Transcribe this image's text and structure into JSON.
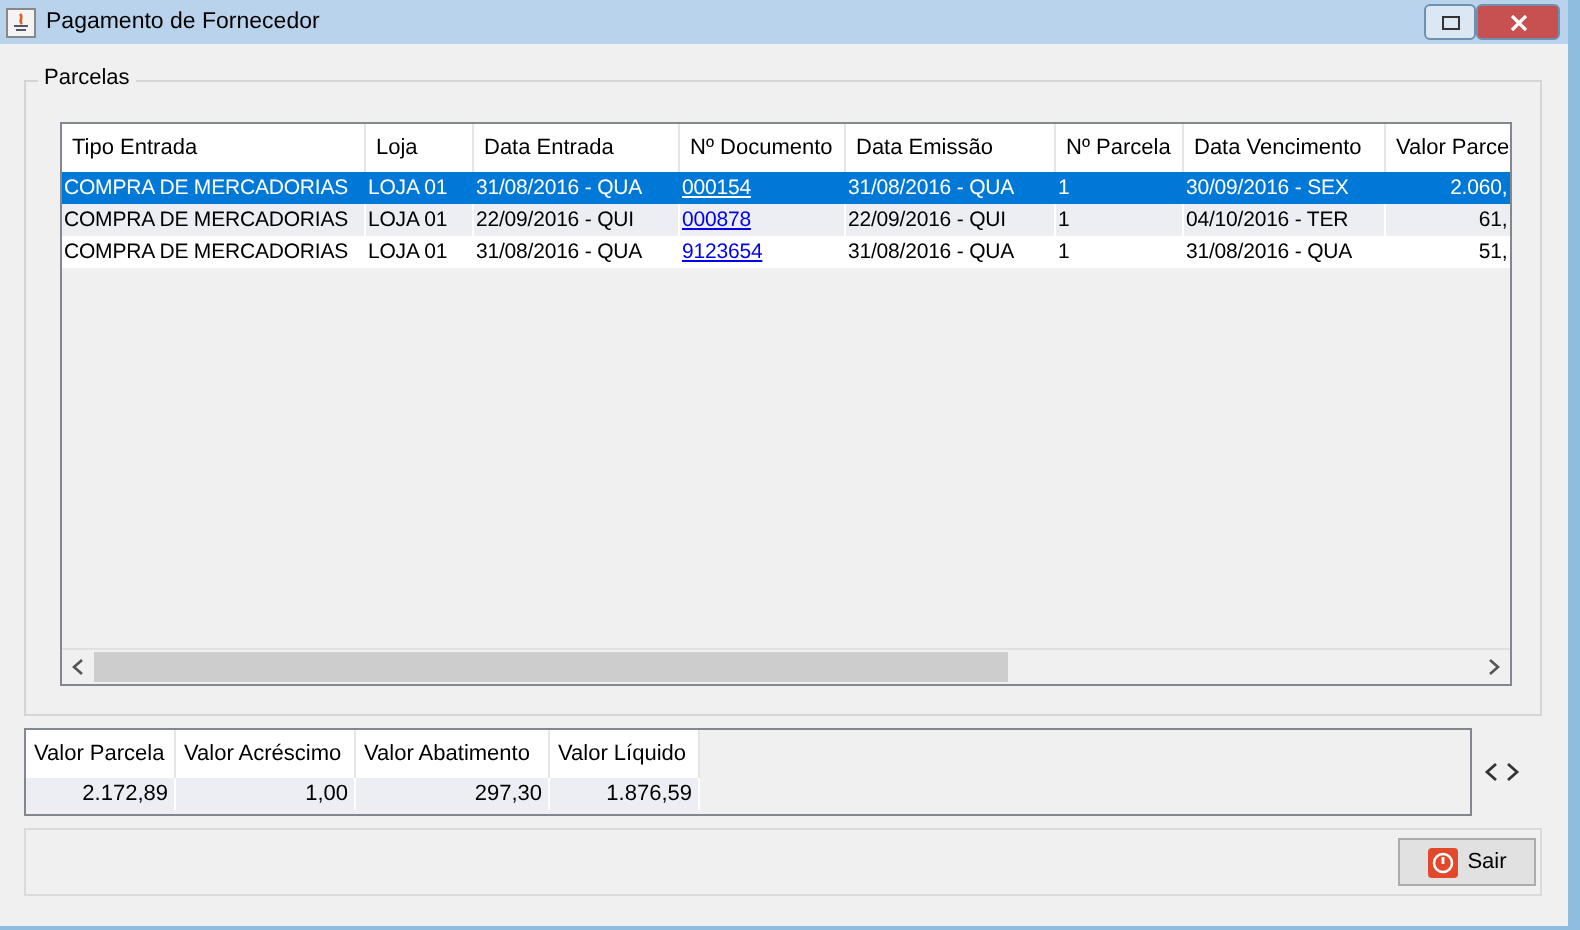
{
  "window": {
    "title": "Pagamento de Fornecedor"
  },
  "parcelas": {
    "title": "Parcelas",
    "columns": [
      {
        "label": "Tipo Entrada",
        "kind": "text"
      },
      {
        "label": "Loja",
        "kind": "text"
      },
      {
        "label": "Data Entrada",
        "kind": "text"
      },
      {
        "label": "Nº Documento",
        "kind": "link"
      },
      {
        "label": "Data Emissão",
        "kind": "text"
      },
      {
        "label": "Nº Parcela",
        "kind": "text"
      },
      {
        "label": "Data Vencimento",
        "kind": "text"
      },
      {
        "label": "Valor Parce",
        "kind": "number"
      }
    ],
    "rows": [
      {
        "selected": true,
        "cells": [
          "COMPRA DE MERCADORIAS",
          "LOJA 01",
          "31/08/2016 - QUA",
          "000154",
          "31/08/2016 - QUA",
          "1",
          "30/09/2016 - SEX",
          "2.060,"
        ]
      },
      {
        "selected": false,
        "cells": [
          "COMPRA DE MERCADORIAS",
          "LOJA 01",
          "22/09/2016 - QUI",
          "000878",
          "22/09/2016 - QUI",
          "1",
          "04/10/2016 - TER",
          "61,"
        ]
      },
      {
        "selected": false,
        "cells": [
          "COMPRA DE MERCADORIAS",
          "LOJA 01",
          "31/08/2016 - QUA",
          "9123654",
          "31/08/2016 - QUA",
          "1",
          "31/08/2016 - QUA",
          "51,"
        ]
      }
    ]
  },
  "totals": [
    {
      "label": "Valor Parcela",
      "value": "2.172,89"
    },
    {
      "label": "Valor Acréscimo",
      "value": "1,00"
    },
    {
      "label": "Valor Abatimento",
      "value": "297,30"
    },
    {
      "label": "Valor Líquido",
      "value": "1.876,59"
    }
  ],
  "buttons": [
    {
      "label": "Sair"
    }
  ]
}
